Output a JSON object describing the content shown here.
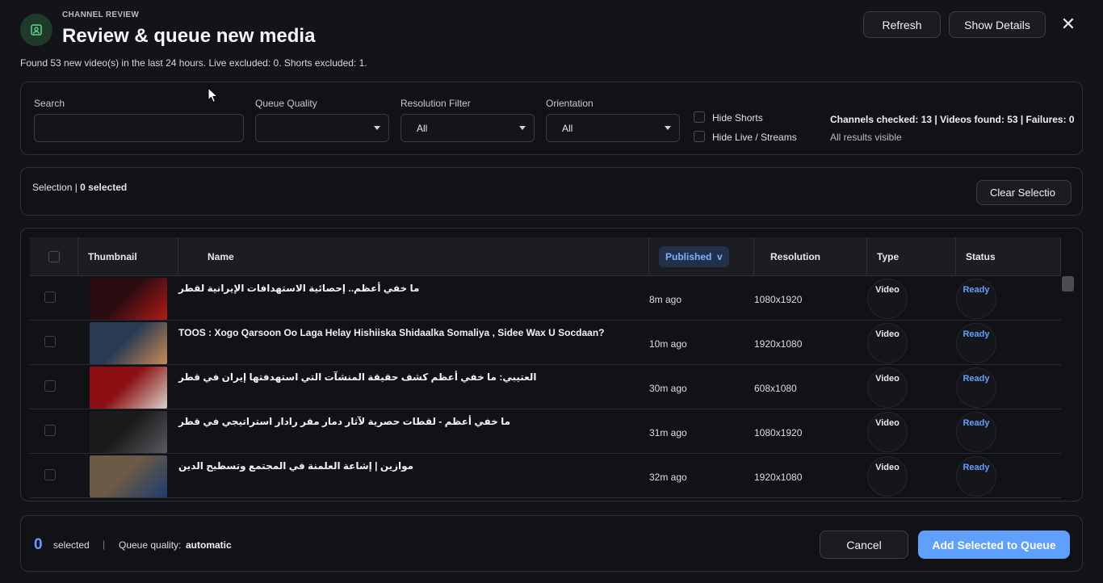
{
  "header": {
    "eyebrow": "CHANNEL REVIEW",
    "title": "Review & queue new media",
    "subtitle": "Found 53 new video(s) in the last 24 hours. Live excluded: 0. Shorts excluded: 1.",
    "refresh_label": "Refresh",
    "details_label": "Show Details",
    "close_glyph": "✕",
    "icon": "user-square-icon"
  },
  "filters": {
    "search_label": "Search",
    "search_value": "",
    "queue_quality_label": "Queue Quality",
    "queue_quality_value": "",
    "resolution_label": "Resolution Filter",
    "resolution_value": "All",
    "orientation_label": "Orientation",
    "orientation_value": "All",
    "hide_shorts_label": "Hide Shorts",
    "hide_live_label": "Hide Live / Streams",
    "stats": "Channels checked: 13 | Videos found: 53 | Failures: 0",
    "stats_sub": "All results visible"
  },
  "selection": {
    "label": "Selection",
    "separator": " | ",
    "count_text": "0 selected",
    "clear_label": "Clear Selectio"
  },
  "table": {
    "columns": {
      "thumbnail": "Thumbnail",
      "name": "Name",
      "published": "Published",
      "sort_indicator": "v",
      "resolution": "Resolution",
      "type": "Type",
      "status": "Status"
    },
    "rows": [
      {
        "name": "ما خفي أعظم.. إحصائية الاستهدافات الإيرانية لقطر",
        "published": "8m ago",
        "resolution": "1080x1920",
        "type": "Video",
        "status": "Ready",
        "thumb_colors": [
          "#2a0c10",
          "#b31a1a"
        ]
      },
      {
        "name": "TOOS : Xogo Qarsoon Oo Laga Helay Hishiiska Shidaalka Somaliya , Sidee Wax U Socdaan?",
        "published": "10m ago",
        "resolution": "1920x1080",
        "type": "Video",
        "status": "Ready",
        "thumb_colors": [
          "#2a3a55",
          "#c88a52"
        ]
      },
      {
        "name": "العتيبي: ما خفي أعظم كشف حقيقة المنشآت التي استهدفتها إيران في قطر",
        "published": "30m ago",
        "resolution": "608x1080",
        "type": "Video",
        "status": "Ready",
        "thumb_colors": [
          "#8c0f14",
          "#d8d2c8"
        ]
      },
      {
        "name": "ما خفي أعظم - لقطات حصرية لآثار دمار مقر رادار استراتيجي في قطر",
        "published": "31m ago",
        "resolution": "1080x1920",
        "type": "Video",
        "status": "Ready",
        "thumb_colors": [
          "#1b1b1d",
          "#5a5a5e"
        ]
      },
      {
        "name": "موازين | إشاعة العلمنة في المجتمع وتسطيح الدين",
        "published": "32m ago",
        "resolution": "1920x1080",
        "type": "Video",
        "status": "Ready",
        "thumb_colors": [
          "#6b5a45",
          "#1d3c6e"
        ]
      }
    ]
  },
  "footer": {
    "count": "0",
    "selected_label": "selected",
    "separator": "|",
    "queue_quality_label": "Queue quality:",
    "queue_quality_value": "automatic",
    "cancel_label": "Cancel",
    "add_label": "Add Selected to Queue"
  },
  "colors": {
    "accent": "#5fa0ff",
    "background": "#141518"
  }
}
